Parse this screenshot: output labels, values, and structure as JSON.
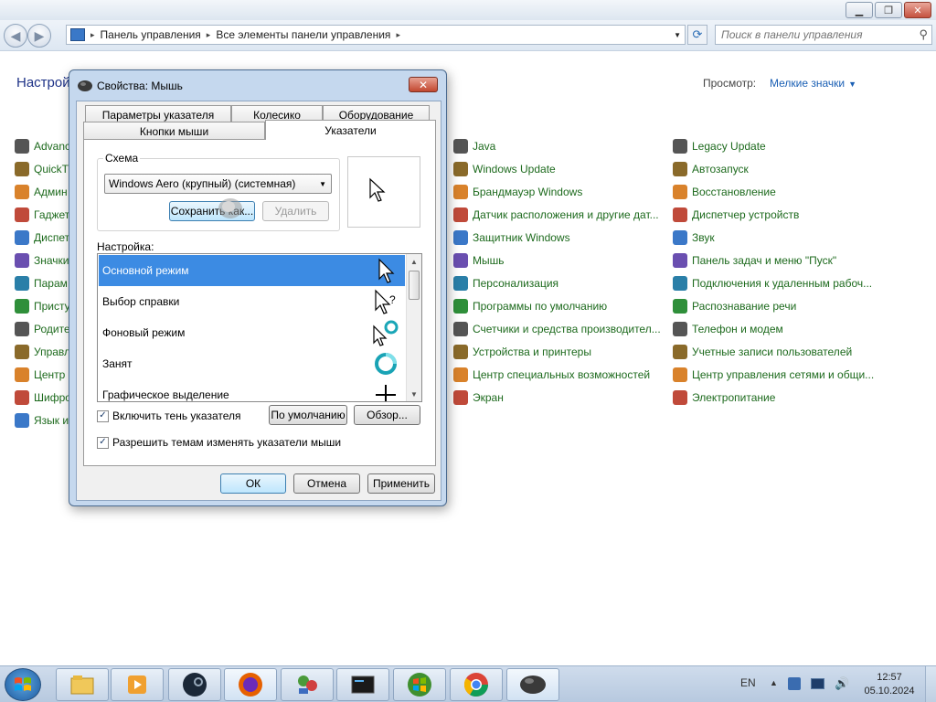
{
  "window": {
    "minimize_icon": "minimize-icon",
    "maximize_icon": "restore-icon",
    "close_icon": "close-icon"
  },
  "address": {
    "crumbs": [
      "Панель управления",
      "Все элементы панели управления"
    ],
    "search_placeholder": "Поиск в панели управления"
  },
  "control_panel": {
    "header": "Настрой",
    "view_label": "Просмотр:",
    "view_value": "Мелкие значки",
    "col1": [
      "Advanc",
      "QuickT",
      "Админ",
      "Гаджет",
      "Диспет",
      "Значки",
      "Парам",
      "Присту",
      "Родите",
      "Управл",
      "Центр",
      "Шифро",
      "Язык и"
    ],
    "col2": [
      "Java",
      "Windows Update",
      "Брандмауэр Windows",
      "Датчик расположения и другие дат...",
      "Защитник Windows",
      "Мышь",
      "Персонализация",
      "Программы по умолчанию",
      "Счетчики и средства производител...",
      "Устройства и принтеры",
      "Центр специальных возможностей",
      "Экран"
    ],
    "col3": [
      "Legacy Update",
      "Автозапуск",
      "Восстановление",
      "Диспетчер устройств",
      "Звук",
      "Панель задач и меню \"Пуск\"",
      "Подключения к удаленным рабоч...",
      "Распознавание речи",
      "Телефон и модем",
      "Учетные записи пользователей",
      "Центр управления сетями и общи...",
      "Электропитание"
    ]
  },
  "dialog": {
    "title": "Свойства: Мышь",
    "tabs_top": [
      "Параметры указателя",
      "Колесико",
      "Оборудование"
    ],
    "tabs_bottom": [
      "Кнопки мыши",
      "Указатели"
    ],
    "scheme_legend": "Схема",
    "scheme_value": "Windows Aero (крупный) (системная)",
    "save_button": "Сохранить как...",
    "delete_button": "Удалить",
    "settings_label": "Настройка:",
    "cursor_rows": [
      "Основной режим",
      "Выбор справки",
      "Фоновый режим",
      "Занят",
      "Графическое выделение"
    ],
    "shadow_checkbox": "Включить тень указателя",
    "default_button": "По умолчанию",
    "browse_button": "Обзор...",
    "themes_checkbox": "Разрешить темам изменять указатели мыши",
    "ok_button": "ОК",
    "cancel_button": "Отмена",
    "apply_button": "Применить"
  },
  "taskbar": {
    "language": "EN",
    "time": "12:57",
    "date": "05.10.2024",
    "apps": [
      "explorer-icon",
      "media-player-icon",
      "steam-icon",
      "firefox-icon",
      "tools-icon",
      "console-icon",
      "windows-update-icon",
      "chrome-icon",
      "mouse-icon"
    ]
  },
  "colors": {
    "link_green": "#1d6a1d",
    "selection_blue": "#3c8be3",
    "header_blue": "#1e3287"
  }
}
